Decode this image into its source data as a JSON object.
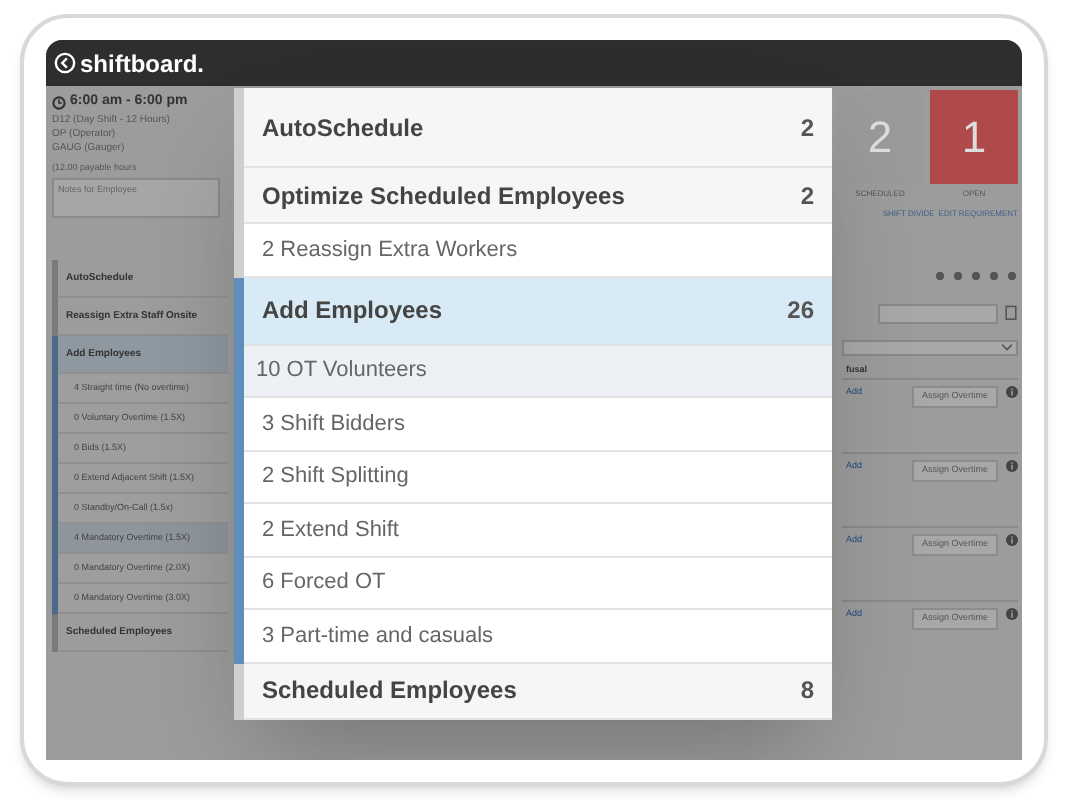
{
  "header": {
    "logo": "shiftboard."
  },
  "shift_panel": {
    "time": "6:00 am - 6:00 pm",
    "details": [
      "D12 (Day Shift - 12 Hours)",
      "OP (Operator)",
      "GAUG (Gauger)"
    ],
    "payable": "(12.00 payable hours",
    "notes_placeholder": "Notes for Employee"
  },
  "side_menu": [
    {
      "title": "AutoSchedule",
      "selected": false
    },
    {
      "title": "Reassign Extra Staff Onsite",
      "selected": false
    },
    {
      "title": "Add Employees",
      "selected": true,
      "items": [
        {
          "label": "4 Straight time (No overtime)",
          "selected": false
        },
        {
          "label": "0 Voluntary Overtime (1.5X)",
          "selected": false
        },
        {
          "label": "0 Bids (1.5X)",
          "selected": false
        },
        {
          "label": "0 Extend Adjacent Shift (1.5X)",
          "selected": false
        },
        {
          "label": "0 Standby/On-Call (1.5x)",
          "selected": false
        },
        {
          "label": "4 Mandatory Overtime (1.5X)",
          "selected": true
        },
        {
          "label": "0 Mandatory Overtime (2.0X)",
          "selected": false
        },
        {
          "label": "0 Mandatory Overtime (3.0X)",
          "selected": false
        }
      ]
    },
    {
      "title": "Scheduled Employees",
      "selected": false
    }
  ],
  "stats": [
    {
      "value": "2",
      "label": "SCHEDULED",
      "color": "#9a9a9a"
    },
    {
      "value": "1",
      "label": "OPEN",
      "color": "#b04a4a"
    }
  ],
  "links": [
    "SHIFT DIVIDE",
    "EDIT REQUIREMENT"
  ],
  "column_header": "fusal",
  "rows": [
    {
      "link": "Add",
      "button": "Assign Overtime"
    },
    {
      "link": "Add",
      "button": "Assign Overtime"
    },
    {
      "link": "Add",
      "button": "Assign Overtime"
    },
    {
      "link": "Add",
      "button": "Assign Overtime"
    }
  ],
  "modal": [
    {
      "title": "AutoSchedule",
      "count": "2",
      "selected": false
    },
    {
      "title": "Optimize Scheduled Employees",
      "count": "2",
      "selected": false,
      "items": [
        {
          "label": "2 Reassign Extra Workers",
          "selected": false
        }
      ]
    },
    {
      "title": "Add Employees",
      "count": "26",
      "selected": true,
      "items": [
        {
          "label": "10 OT Volunteers",
          "selected": true
        },
        {
          "label": "3 Shift Bidders",
          "selected": false
        },
        {
          "label": "2 Shift Splitting",
          "selected": false
        },
        {
          "label": "2 Extend Shift",
          "selected": false
        },
        {
          "label": "6 Forced OT",
          "selected": false
        },
        {
          "label": "3 Part-time and casuals",
          "selected": false
        }
      ]
    },
    {
      "title": "Scheduled Employees",
      "count": "8",
      "selected": false
    }
  ]
}
